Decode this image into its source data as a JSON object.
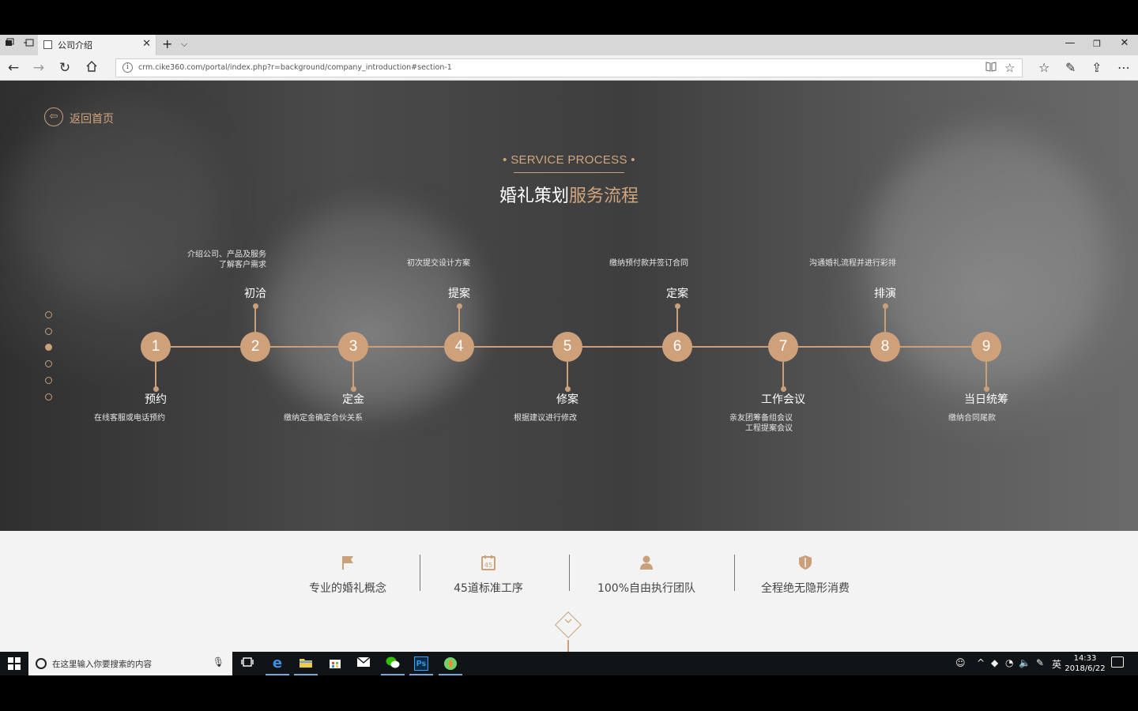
{
  "browser": {
    "tab_title": "公司介绍",
    "url": "crm.cike360.com/portal/index.php?r=background/company_introduction#section-1",
    "icons": [
      "tab-manager-icon",
      "set-aside-tabs-icon",
      "new-tab-icon",
      "tab-list-icon",
      "minimize-icon",
      "maximize-icon",
      "close-icon",
      "back-icon",
      "forward-icon",
      "refresh-icon",
      "home-icon",
      "info-icon",
      "reading-view-icon",
      "favorite-star-icon",
      "favorites-icon",
      "notes-icon",
      "share-icon",
      "more-icon"
    ]
  },
  "page": {
    "back_label": "返回首页",
    "section_subtitle": "• SERVICE PROCESS •",
    "title_main": "婚礼策划",
    "title_accent": "服务流程",
    "nav_dots": [
      false,
      false,
      true,
      false,
      false,
      false
    ],
    "steps": [
      {
        "num": "1",
        "title": "预约",
        "desc": "在线客服或电话预约",
        "position": "below"
      },
      {
        "num": "2",
        "title": "初洽",
        "desc": "介绍公司、产品及服务\n了解客户需求",
        "position": "above"
      },
      {
        "num": "3",
        "title": "定金",
        "desc": "缴纳定金确定合伙关系",
        "position": "below"
      },
      {
        "num": "4",
        "title": "提案",
        "desc": "初次提交设计方案",
        "position": "above"
      },
      {
        "num": "5",
        "title": "修案",
        "desc": "根据建议进行修改",
        "position": "below"
      },
      {
        "num": "6",
        "title": "定案",
        "desc": "缴纳预付款并签订合同",
        "position": "above"
      },
      {
        "num": "7",
        "title": "工作会议",
        "desc": "亲友团筹备组会议\n工程提案会议",
        "position": "below"
      },
      {
        "num": "8",
        "title": "排演",
        "desc": "沟通婚礼流程并进行彩排",
        "position": "above"
      },
      {
        "num": "9",
        "title": "当日统筹",
        "desc": "缴纳合同尾款",
        "position": "below"
      }
    ],
    "features": [
      {
        "label": "专业的婚礼概念",
        "icon": "flag-icon"
      },
      {
        "label": "45道标准工序",
        "icon": "calendar-45-icon",
        "icon_text": "45"
      },
      {
        "label": "100%自由执行团队",
        "icon": "person-icon"
      },
      {
        "label": "全程绝无隐形消费",
        "icon": "shield-icon"
      }
    ],
    "accent_color": "#c9a07a"
  },
  "taskbar": {
    "search_placeholder": "在这里输入你要搜索的内容",
    "apps": [
      "task-view-icon",
      "edge-icon",
      "file-explorer-icon",
      "store-icon",
      "mail-icon",
      "wechat-icon",
      "photoshop-icon",
      "app-icon"
    ],
    "photoshop_label": "Ps",
    "ime": "英",
    "time": "14:33",
    "date": "2018/6/22"
  }
}
